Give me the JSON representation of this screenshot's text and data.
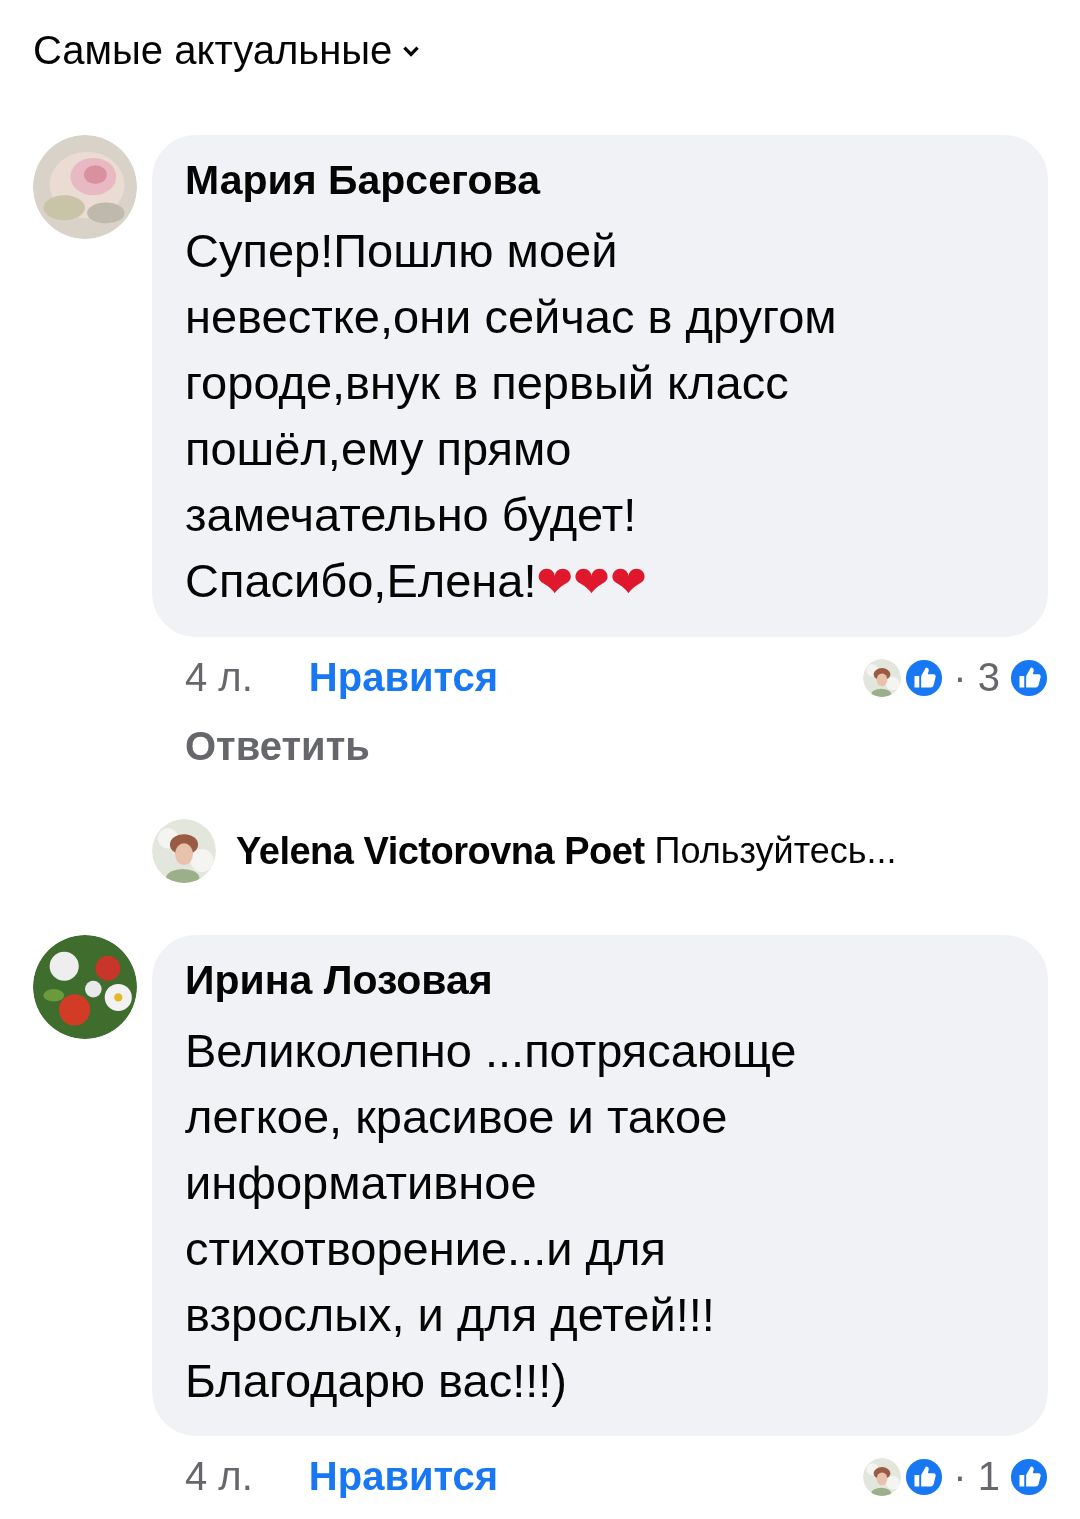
{
  "sort": {
    "label": "Самые актуальные",
    "expanded": false
  },
  "comments": [
    {
      "author": "Мария Барсегова",
      "text": "Супер!Пошлю моей\nневестке,они сейчас в другом\nгороде,внук в первый класс\nпошёл,ему прямо\nзамечательно будет!\nСпасибо,Елена!",
      "emoji": "❤❤❤",
      "time": "4 л.",
      "like": "Нравится",
      "liked": true,
      "reply": "Ответить",
      "reaction_count": "· 3",
      "replies": [
        {
          "author": "Yelena Victorovna Poet",
          "text": "Пользуйтесь..."
        }
      ]
    },
    {
      "author": "Ирина Лозовая",
      "text": "Великолепно ...потрясающе\nлегкое, красивое и такое\nинформативное\nстихотворение...и для\nвзрослых, и для детей!!!\nБлагодарю вас!!!)",
      "time": "4 л.",
      "like": "Нравится",
      "liked": true,
      "reaction_count": "· 1"
    }
  ]
}
